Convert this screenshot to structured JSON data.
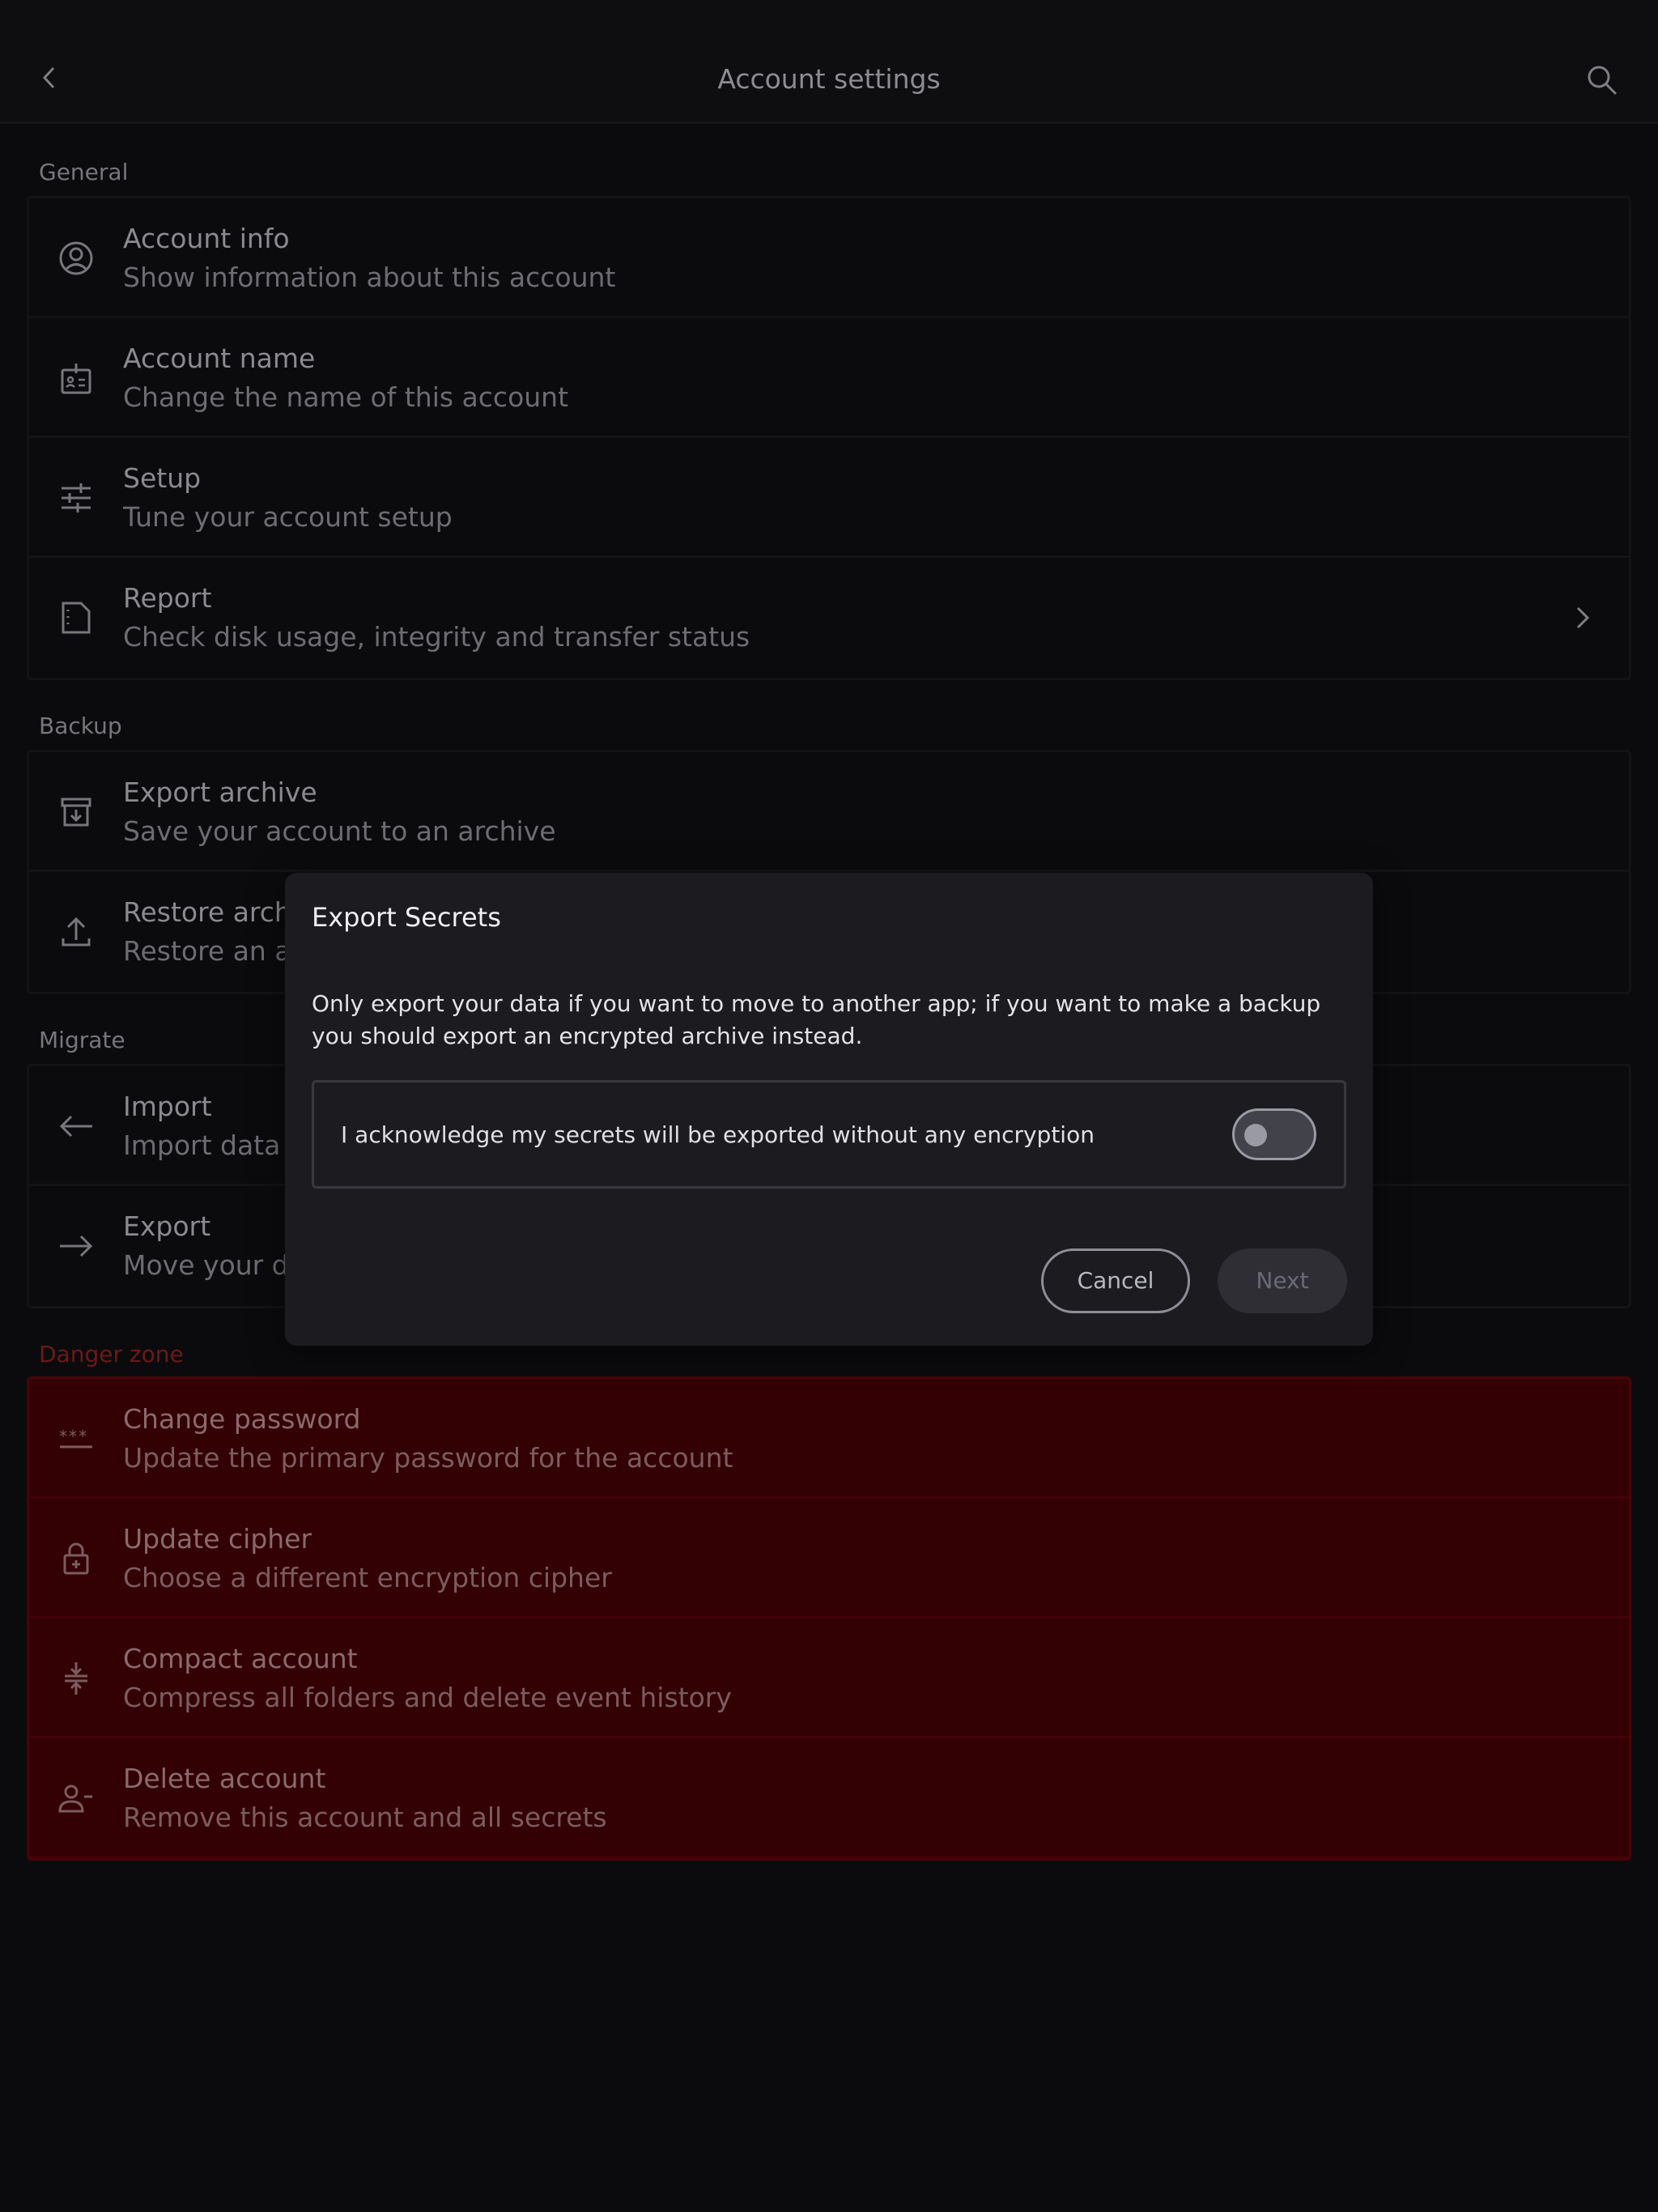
{
  "header": {
    "title": "Account settings"
  },
  "sections": {
    "general": {
      "label": "General",
      "items": [
        {
          "label": "Account info",
          "sub": "Show information about this account",
          "icon": "user-circle-icon"
        },
        {
          "label": "Account name",
          "sub": "Change the name of this account",
          "icon": "id-badge-icon"
        },
        {
          "label": "Setup",
          "sub": "Tune your account setup",
          "icon": "sliders-icon"
        },
        {
          "label": "Report",
          "sub": "Check disk usage, integrity and transfer status",
          "icon": "document-icon"
        }
      ]
    },
    "backup": {
      "label": "Backup",
      "items": [
        {
          "label": "Export archive",
          "sub": "Save your account to an archive",
          "icon": "archive-download-icon"
        },
        {
          "label": "Restore archive",
          "sub": "Restore an account from an archive",
          "icon": "upload-icon"
        }
      ]
    },
    "migrate": {
      "label": "Migrate",
      "items": [
        {
          "label": "Import",
          "sub": "Import data from another app",
          "icon": "arrow-left-icon"
        },
        {
          "label": "Export",
          "sub": "Move your data to another app",
          "icon": "arrow-right-icon"
        }
      ]
    },
    "danger": {
      "label": "Danger zone",
      "items": [
        {
          "label": "Change password",
          "sub": "Update the primary password for the account",
          "icon": "password-icon"
        },
        {
          "label": "Update cipher",
          "sub": "Choose a different encryption cipher",
          "icon": "lock-plus-icon"
        },
        {
          "label": "Compact account",
          "sub": "Compress all folders and delete event history",
          "icon": "compress-icon"
        },
        {
          "label": "Delete account",
          "sub": "Remove this account and all secrets",
          "icon": "user-remove-icon"
        }
      ]
    }
  },
  "dialog": {
    "title": "Export Secrets",
    "body": "Only export your data if you want to move to another app; if you want to make a backup you should export an encrypted archive instead.",
    "acknowledge": "I acknowledge my secrets will be exported without any encryption",
    "toggle_on": false,
    "cancel": "Cancel",
    "next": "Next"
  },
  "colors": {
    "danger_bg": "#330004",
    "danger_text": "#6e1818",
    "dialog_bg": "#1c1c20"
  }
}
